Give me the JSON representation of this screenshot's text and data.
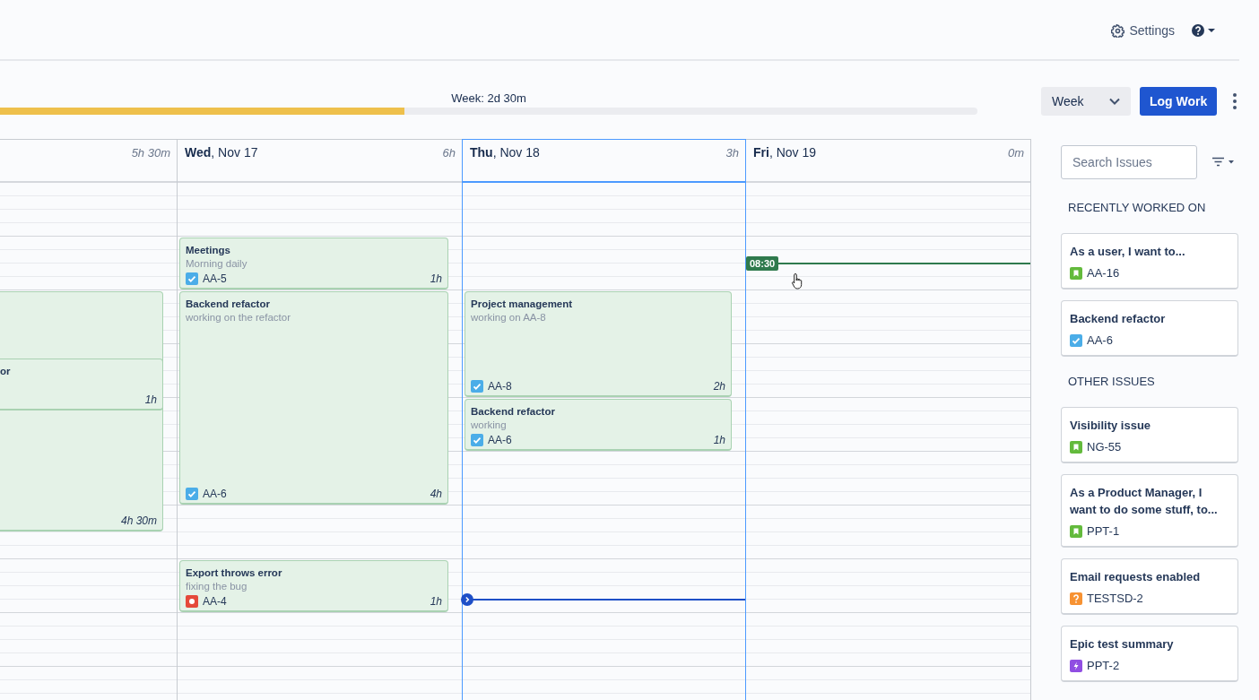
{
  "topbar": {
    "settings": "Settings"
  },
  "toolbar": {
    "week_label": "Week: 2d 30m",
    "week_progress": {
      "level": 0.414
    },
    "view_select": {
      "value": "Week"
    },
    "log_button": "Log Work"
  },
  "days": [
    {
      "total": "5h 30m",
      "today": false,
      "events": [
        {
          "duration": "4h 30m",
          "overlaps": [
            {
              "title": "or",
              "duration": "1h"
            }
          ]
        }
      ]
    },
    {
      "label": "**Wed**, Nov 17",
      "total": "6h",
      "today": false,
      "events": [
        {
          "title": "Meetings",
          "description": "Morning daily",
          "issue": {
            "key": "AA-5",
            "kind": "task"
          },
          "duration": "1h"
        },
        {
          "title": "Backend refactor",
          "description": "working on the refactor",
          "issue": {
            "key": "AA-6",
            "kind": "task"
          },
          "duration": "4h"
        },
        {
          "title": "Export throws error",
          "description": "fixing the bug",
          "issue": {
            "key": "AA-4",
            "kind": "bug"
          },
          "duration": "1h"
        }
      ]
    },
    {
      "label": "**Thu**, Nov 18",
      "total": "3h",
      "today": true,
      "current_time_line": true,
      "events": [
        {
          "title": "Project management",
          "description": "working on AA-8",
          "issue": {
            "key": "AA-8",
            "kind": "task"
          },
          "duration": "2h"
        },
        {
          "title": "Backend refactor",
          "description": "working",
          "issue": {
            "key": "AA-6",
            "kind": "task"
          },
          "duration": "1h"
        }
      ]
    },
    {
      "label": "**Fri**, Nov 19",
      "total": "0m",
      "today": false,
      "hover_time": "08:30"
    }
  ],
  "sidebar": {
    "search": {
      "placeholder": "Search Issues"
    },
    "sections": [
      {
        "heading": "RECENTLY WORKED ON",
        "issues": [
          {
            "summary": "As a user, I want to...",
            "key": "AA-16",
            "kind": "story"
          },
          {
            "summary": "Backend refactor",
            "key": "AA-6",
            "kind": "task"
          }
        ]
      },
      {
        "heading": "OTHER ISSUES",
        "issues": [
          {
            "summary": "Visibility issue",
            "key": "NG-55",
            "kind": "story"
          },
          {
            "summary": "As a Product Manager, I want to do some stuff, to...",
            "key": "PPT-1",
            "kind": "story"
          },
          {
            "summary": "Email requests enabled",
            "key": "TESTSD-2",
            "kind": "question"
          },
          {
            "summary": "Epic test summary",
            "key": "PPT-2",
            "kind": "epic"
          }
        ]
      }
    ]
  }
}
